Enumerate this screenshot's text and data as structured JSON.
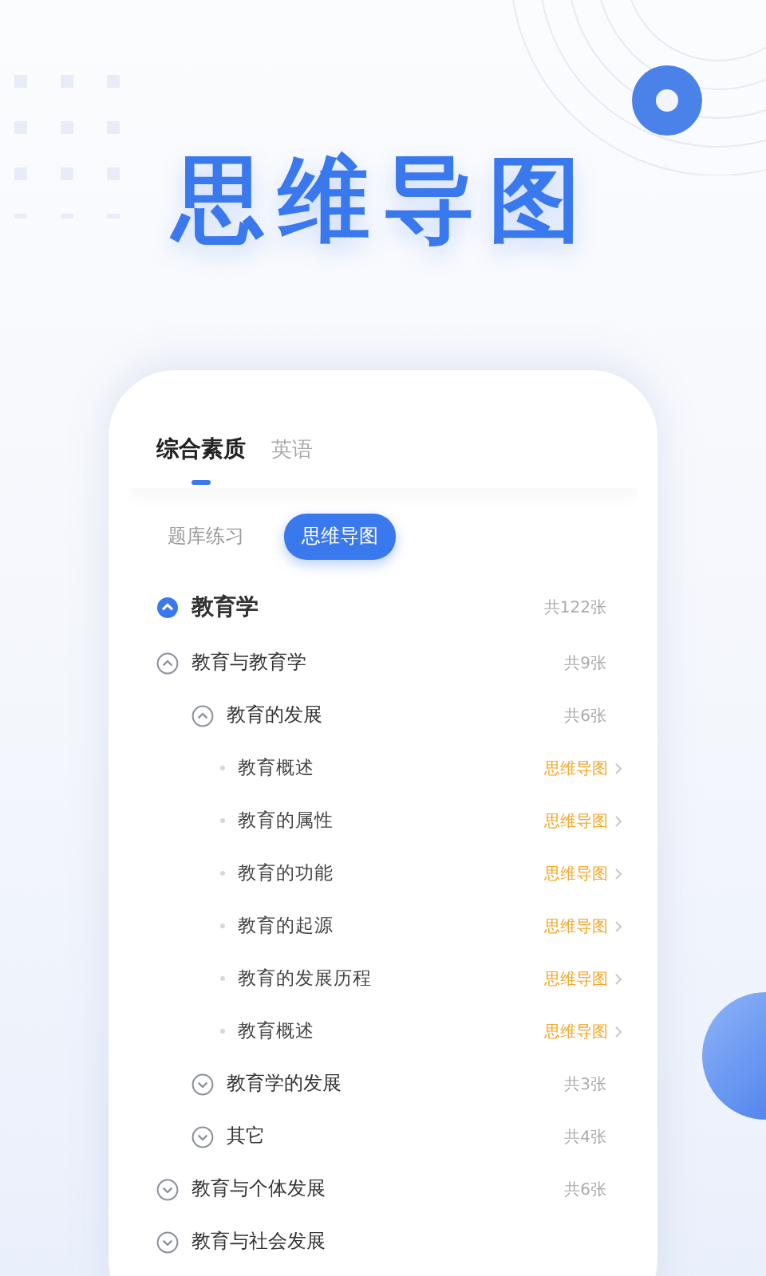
{
  "headline": "思维导图",
  "tabs": [
    {
      "label": "综合素质",
      "selected": true
    },
    {
      "label": "英语",
      "selected": false
    }
  ],
  "segments": [
    {
      "label": "题库练习",
      "selected": false
    },
    {
      "label": "思维导图",
      "selected": true
    }
  ],
  "tree": {
    "title": "教育学",
    "count": "共122张",
    "expanded": true,
    "children": [
      {
        "kind": "group",
        "title": "教育与教育学",
        "count": "共9张",
        "expanded": true,
        "children": [
          {
            "kind": "group",
            "title": "教育的发展",
            "count": "共6张",
            "expanded": true,
            "children": [
              {
                "kind": "leaf",
                "title": "教育概述",
                "link": "思维导图"
              },
              {
                "kind": "leaf",
                "title": "教育的属性",
                "link": "思维导图"
              },
              {
                "kind": "leaf",
                "title": "教育的功能",
                "link": "思维导图"
              },
              {
                "kind": "leaf",
                "title": "教育的起源",
                "link": "思维导图"
              },
              {
                "kind": "leaf",
                "title": "教育的发展历程",
                "link": "思维导图"
              },
              {
                "kind": "leaf",
                "title": "教育概述",
                "link": "思维导图"
              }
            ]
          },
          {
            "kind": "group",
            "title": "教育学的发展",
            "count": "共3张",
            "expanded": false
          },
          {
            "kind": "group",
            "title": "其它",
            "count": "共4张",
            "expanded": false
          }
        ]
      },
      {
        "kind": "group",
        "title": "教育与个体发展",
        "count": "共6张",
        "expanded": false
      },
      {
        "kind": "group",
        "title": "教育与社会发展",
        "expanded": false
      }
    ]
  }
}
